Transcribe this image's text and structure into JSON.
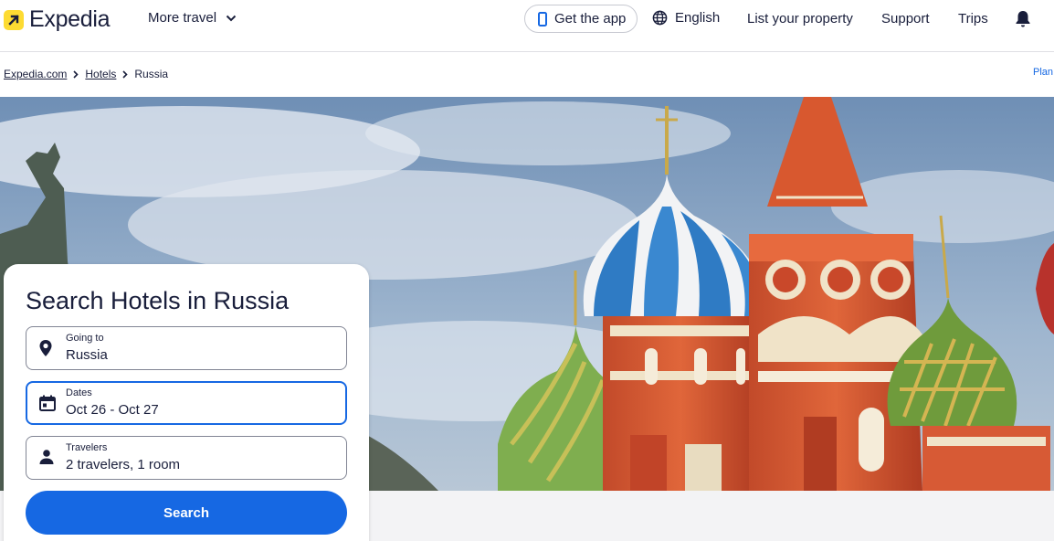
{
  "brand": {
    "name": "Expedia",
    "logo_color": "#fddb32"
  },
  "header": {
    "more_travel": "More travel",
    "get_app": "Get the app",
    "language": "English",
    "list_property": "List your property",
    "support": "Support",
    "trips": "Trips"
  },
  "breadcrumb": {
    "items": [
      "Expedia.com",
      "Hotels",
      "Russia"
    ],
    "right_link": "Plan"
  },
  "search_card": {
    "title": "Search Hotels in Russia",
    "destination": {
      "label": "Going to",
      "value": "Russia",
      "icon": "map-pin-icon"
    },
    "dates": {
      "label": "Dates",
      "value": "Oct 26 - Oct 27",
      "icon": "calendar-icon"
    },
    "travelers": {
      "label": "Travelers",
      "value": "2 travelers, 1 room",
      "icon": "person-icon"
    },
    "search_button": "Search"
  },
  "colors": {
    "accent": "#1668e3",
    "text": "#191e3b"
  }
}
